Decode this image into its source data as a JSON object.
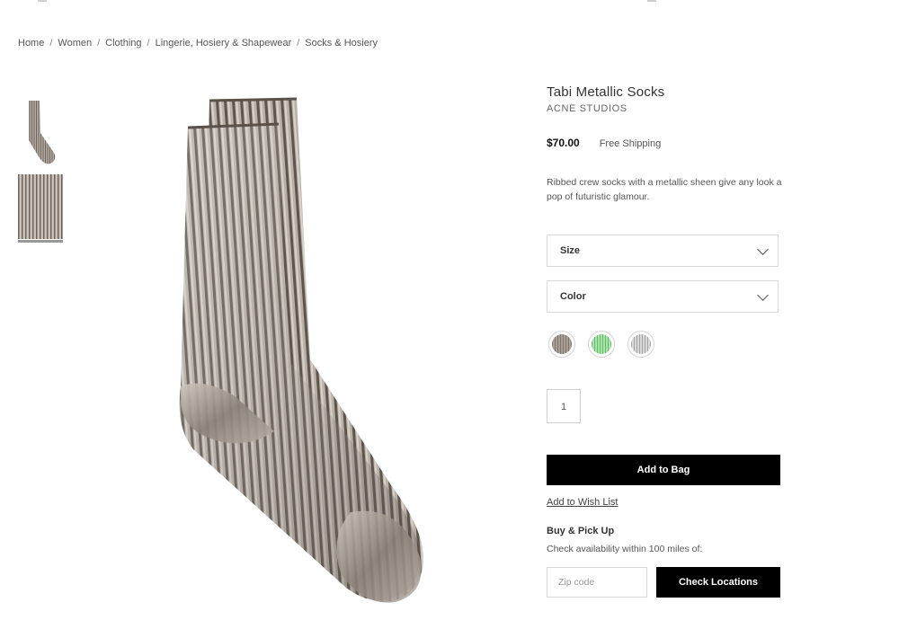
{
  "breadcrumb": [
    "Home",
    "Women",
    "Clothing",
    "Lingerie, Hosiery & Shapewear",
    "Socks & Hosiery"
  ],
  "product": {
    "title": "Tabi Metallic Socks",
    "brand": "ACNE STUDIOS",
    "price": "$70.00",
    "shipping": "Free Shipping",
    "description": "Ribbed crew socks with a metallic sheen give any look a pop of futuristic glamour."
  },
  "options": {
    "size_label": "Size",
    "color_label": "Color"
  },
  "swatches": [
    {
      "name": "bronze",
      "color": "#a89e94"
    },
    {
      "name": "green",
      "color": "#9fe9a2"
    },
    {
      "name": "silver",
      "color": "#d9d9d9"
    }
  ],
  "quantity": "1",
  "actions": {
    "add_to_bag": "Add to Bag",
    "wish_list": "Add to Wish List"
  },
  "pickup": {
    "title": "Buy & Pick Up",
    "subtitle": "Check availability within 100 miles of:",
    "zip_placeholder": "Zip code",
    "check_label": "Check Locations"
  }
}
